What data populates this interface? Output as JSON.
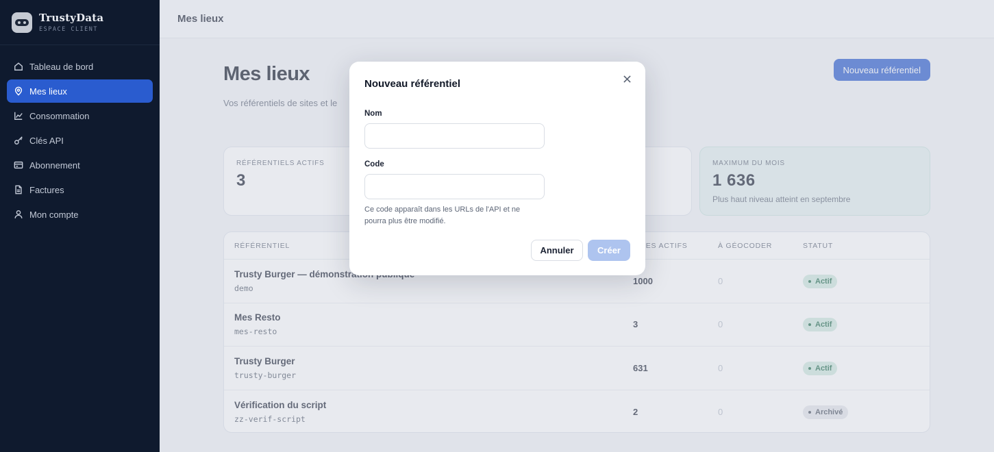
{
  "brand": {
    "name": "TrustyData",
    "subtitle": "ESPACE CLIENT"
  },
  "sidebar": {
    "items": [
      {
        "label": "Tableau de bord",
        "icon": "home-icon"
      },
      {
        "label": "Mes lieux",
        "icon": "map-pin-icon",
        "active": true
      },
      {
        "label": "Consommation",
        "icon": "line-chart-icon"
      },
      {
        "label": "Clés API",
        "icon": "key-icon"
      },
      {
        "label": "Abonnement",
        "icon": "credit-card-icon"
      },
      {
        "label": "Factures",
        "icon": "file-icon"
      },
      {
        "label": "Mon compte",
        "icon": "user-icon"
      }
    ]
  },
  "topbar": {
    "title": "Mes lieux"
  },
  "main": {
    "title": "Mes lieux",
    "subtitle": "Vos référentiels de sites et le",
    "new_button": "Nouveau référentiel",
    "stats": [
      {
        "label": "RÉFÉRENTIELS ACTIFS",
        "value": "3"
      },
      {
        "label": "",
        "value": ""
      },
      {
        "label": "MAXIMUM DU MOIS",
        "value": "1 636",
        "note": "Plus haut niveau atteint en septembre"
      }
    ],
    "table": {
      "headers": {
        "ref": "RÉFÉRENTIEL",
        "sites": "SITES ACTIFS",
        "geo": "À GÉOCODER",
        "status": "STATUT"
      },
      "rows": [
        {
          "name": "Trusty Burger — démonstration publique",
          "code": "demo",
          "sites": "1000",
          "geo": "0",
          "status": "Actif"
        },
        {
          "name": "Mes Resto",
          "code": "mes-resto",
          "sites": "3",
          "geo": "0",
          "status": "Actif"
        },
        {
          "name": "Trusty Burger",
          "code": "trusty-burger",
          "sites": "631",
          "geo": "0",
          "status": "Actif"
        },
        {
          "name": "Vérification du script",
          "code": "zz-verif-script",
          "sites": "2",
          "geo": "0",
          "status": "Archivé"
        }
      ]
    }
  },
  "modal": {
    "title": "Nouveau référentiel",
    "name_label": "Nom",
    "name_value": "",
    "code_label": "Code",
    "code_value": "",
    "hint": "Ce code apparaît dans les URLs de l'API et ne pourra plus être modifié.",
    "cancel": "Annuler",
    "create": "Créer"
  },
  "colors": {
    "accent": "#2a5ccf",
    "sidebar_bg": "#0f1a2e",
    "success_bg": "#cfe9de",
    "success_text": "#1f6b4c"
  }
}
